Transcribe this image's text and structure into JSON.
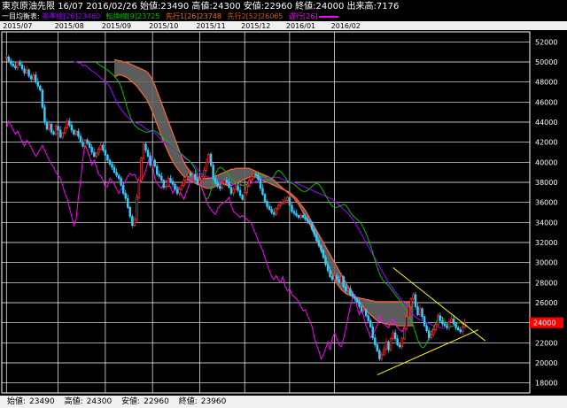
{
  "header": {
    "instrument": "東京原油先限",
    "contract": "16/07",
    "date": "2016/02/26",
    "open_label": "始値:",
    "open": "23490",
    "high_label": "高値:",
    "high": "24300",
    "low_label": "安値:",
    "low": "22960",
    "close_label": "終値:",
    "close": "24000",
    "volume_label": "出来高:",
    "volume": "7176"
  },
  "legend": {
    "title": "一目均衡表:",
    "items": [
      {
        "label": "基準線[26]23460",
        "color": "#9900ff"
      },
      {
        "label": "転換線[9]23725",
        "color": "#00c000"
      },
      {
        "label": "先行1[26]23748",
        "color": "#ff6600"
      },
      {
        "label": "先行2[52]26065",
        "color": "#c06000"
      },
      {
        "label": "遅行[26]",
        "color": "#ff00ff"
      }
    ]
  },
  "footer": {
    "open_label": "始値:",
    "open": "23490",
    "high_label": "高値:",
    "high": "24300",
    "low_label": "安値:",
    "low": "22960",
    "close_label": "終値:",
    "close": "23960"
  },
  "chart_data": {
    "type": "candlestick",
    "x_labels": [
      "2015/07",
      "2015/08",
      "2015/09",
      "2015/10",
      "2015/11",
      "2015/12",
      "2016/01",
      "2016/02"
    ],
    "y_ticks": [
      18000,
      20000,
      22000,
      24000,
      26000,
      28000,
      30000,
      32000,
      34000,
      36000,
      38000,
      40000,
      42000,
      44000,
      46000,
      48000,
      50000,
      52000
    ],
    "ylim": [
      17000,
      53000
    ],
    "last_price_label": "24000",
    "colors": {
      "up": "#ff3333",
      "down": "#33ccff",
      "kijun": "#9900ff",
      "tenkan": "#00c000",
      "chikou": "#ff00ff",
      "cloud_edge": "#ff6633",
      "cloud_fill": "#666666",
      "trend": "#ffff00",
      "grid": "#ffffff",
      "price_tag": "#ff0000"
    },
    "closes": [
      50500,
      50100,
      49800,
      49600,
      49400,
      50000,
      49700,
      49300,
      48900,
      49200,
      48600,
      48300,
      48700,
      48000,
      47600,
      47200,
      45500,
      44000,
      43300,
      43800,
      43000,
      42800,
      43600,
      43200,
      42500,
      42900,
      43400,
      44100,
      43700,
      43200,
      42800,
      43100,
      42600,
      42000,
      41600,
      42200,
      41900,
      41500,
      41000,
      40600,
      40900,
      41300,
      41700,
      41200,
      40700,
      40200,
      39800,
      39500,
      39000,
      38700,
      38400,
      37700,
      36900,
      36400,
      35500,
      34600,
      33700,
      34300,
      36500,
      38200,
      40400,
      41800,
      41200,
      40600,
      39700,
      40200,
      39600,
      38800,
      38600,
      38200,
      37500,
      37600,
      38400,
      38100,
      37800,
      37300,
      36900,
      37300,
      37700,
      38200,
      38600,
      38900,
      38700,
      38800,
      38300,
      37900,
      38200,
      38600,
      39200,
      40000,
      40800,
      39700,
      38400,
      37900,
      37600,
      37400,
      37900,
      38200,
      38000,
      37500,
      36900,
      37300,
      37600,
      37200,
      36700,
      36300,
      37000,
      37600,
      38200,
      38600,
      38800,
      38700,
      38300,
      37400,
      36800,
      36100,
      35600,
      35300,
      35000,
      34800,
      35400,
      35700,
      35900,
      36000,
      36200,
      36500,
      35700,
      35100,
      34900,
      34700,
      34500,
      34700,
      34500,
      34300,
      34100,
      33900,
      33300,
      32800,
      32200,
      31700,
      31200,
      30500,
      29800,
      29200,
      28600,
      28300,
      28700,
      28300,
      28000,
      28600,
      27600,
      27200,
      27400,
      26800,
      26600,
      26400,
      26100,
      25600,
      25200,
      25300,
      24700,
      24200,
      23600,
      22500,
      21800,
      21200,
      20400,
      20800,
      21400,
      22100,
      21300,
      22400,
      23000,
      22400,
      21800,
      21600,
      22400,
      23400,
      24600,
      25600,
      26400,
      26800,
      25600,
      24800,
      25400,
      24600,
      23700,
      23200,
      22500,
      22800,
      23300,
      23800,
      24700,
      24200,
      23900,
      23700,
      23500,
      24100,
      24400,
      23900,
      23500,
      23300,
      23100,
      23600,
      24000
    ],
    "kijun": [
      50000,
      50000,
      49900,
      49900,
      49600,
      49700,
      49500,
      49300,
      49100,
      49000,
      48800,
      48600,
      48400,
      48200,
      48000,
      47800,
      47500,
      47000,
      46500,
      46000,
      45600,
      45300,
      45000,
      44700,
      44500,
      44300,
      44100,
      44000,
      43900,
      43800,
      43700,
      43500,
      43300,
      43200,
      43100,
      43000,
      42900,
      42700,
      42500,
      42200,
      42000,
      41900,
      41800,
      41700,
      41500,
      41300,
      41100,
      40900,
      40700,
      40500,
      40300,
      40200,
      40000,
      39800,
      39600,
      39300,
      39000,
      38800,
      38700,
      38600,
      38500,
      38500,
      38400,
      38300,
      38200,
      38200,
      38100,
      38000,
      38000,
      37900,
      37800,
      37800,
      37800,
      37700,
      37700,
      37700,
      37700,
      37800,
      37800,
      37900,
      38000,
      38100,
      38200,
      38300,
      38300,
      38400,
      38400,
      38500,
      38500,
      38500,
      38500,
      38500,
      38400,
      38300,
      38200,
      38100,
      38100,
      38000,
      38000,
      37900,
      37800,
      37700,
      37600,
      37500,
      37400,
      37300,
      37200,
      37100,
      37000,
      36900,
      36800,
      36700,
      36600,
      36500,
      36400,
      36300,
      36100,
      35900,
      35700,
      35500,
      35300,
      35100,
      34900,
      34600,
      34300,
      34000,
      33600,
      33200,
      32800,
      32400,
      32000,
      31600,
      31200,
      30800,
      30400,
      30000,
      29600,
      29200,
      28800,
      28400,
      28000,
      27700,
      27400,
      27100,
      26800,
      26500,
      26200,
      25900,
      25600,
      25300,
      25000,
      24800,
      24600,
      24400,
      24300,
      24200,
      24100,
      24000,
      23900,
      23800,
      23700,
      23600,
      23600,
      23500,
      23500,
      23400
    ],
    "kijun_start": 30,
    "tenkan": [
      49900,
      49800,
      49600,
      49500,
      49300,
      49200,
      49000,
      48800,
      48600,
      48300,
      48000,
      47500,
      46800,
      46000,
      45200,
      44600,
      44000,
      43700,
      43500,
      43300,
      43200,
      43100,
      43000,
      43000,
      43100,
      43200,
      43100,
      43000,
      42800,
      42600,
      42400,
      42200,
      42000,
      41800,
      41600,
      41400,
      41200,
      41000,
      40800,
      40600,
      40400,
      40200,
      40000,
      39700,
      39300,
      38800,
      38100,
      37400,
      36700,
      36300,
      36500,
      37200,
      38000,
      38800,
      39300,
      39500,
      39400,
      39200,
      39000,
      38700,
      38400,
      38200,
      38000,
      37900,
      37800,
      37700,
      37700,
      37800,
      38000,
      38200,
      38400,
      38600,
      38700,
      38800,
      38700,
      38500,
      38300,
      38200,
      38300,
      38600,
      39000,
      39200,
      39100,
      38800,
      38500,
      38200,
      38000,
      37900,
      37800,
      37600,
      37400,
      37200,
      37100,
      37100,
      37200,
      37400,
      37600,
      37800,
      37900,
      37800,
      37500,
      37100,
      36700,
      36300,
      35900,
      35600,
      35500,
      35500,
      35600,
      35700,
      35800,
      35700,
      35400,
      35000,
      34700,
      34500,
      34300,
      34100,
      33800,
      33400,
      32900,
      32300,
      31700,
      31000,
      30200,
      29500,
      28900,
      28400,
      28100,
      27900,
      27700,
      27400,
      27100,
      26800,
      26500,
      26200,
      25900,
      25600,
      25200,
      24800,
      24300,
      23700,
      23000,
      22300,
      21800,
      21500,
      21600,
      22000,
      22500,
      23000,
      23500,
      24000,
      24400,
      24600,
      24500,
      24200,
      23900,
      23700,
      23600,
      23700,
      23900,
      24000,
      24000,
      23900,
      23800,
      23700
    ],
    "tenkan_start": 40,
    "senkou_a": [
      48500,
      48600,
      48700,
      48700,
      48600,
      48500,
      48400,
      48200,
      48000,
      47800,
      47600,
      47300,
      47000,
      46700,
      46400,
      46000,
      45500,
      45000,
      44400,
      43800,
      43200,
      42600,
      42000,
      41500,
      41000,
      40500,
      40100,
      39700,
      39400,
      39100,
      38800,
      38600,
      38400,
      38200,
      38100,
      38000,
      37900,
      37800,
      37700,
      37600,
      37500,
      37400,
      37400,
      37400,
      37500,
      37600,
      37700,
      37800,
      37800,
      37800,
      37700,
      37700,
      37700,
      37800,
      37900,
      38000,
      38100,
      38200,
      38300,
      38400,
      38500,
      38600,
      38600,
      38500,
      38400,
      38300,
      38200,
      38100,
      38000,
      37900,
      37800,
      37700,
      37600,
      37500,
      37400,
      37300,
      37200,
      37100,
      37000,
      36800,
      36600,
      36400,
      36100,
      35800,
      35500,
      35200,
      34800,
      34400,
      34000,
      33600,
      33200,
      32800,
      32400,
      32000,
      31600,
      31200,
      30800,
      30400,
      30000,
      29600,
      29200,
      28800,
      28400,
      28000,
      27600,
      27300,
      27000,
      26700,
      26400,
      26100,
      25800,
      25500,
      25200,
      25000,
      24800,
      24600,
      24400,
      24200,
      24100,
      24000,
      23900,
      23900,
      23800,
      23800,
      23800,
      23800,
      23700,
      23700,
      23700,
      23700,
      23700,
      23700,
      23700,
      23700
    ],
    "senkou_b": [
      50200,
      50200,
      50100,
      50100,
      50000,
      50000,
      49900,
      49800,
      49700,
      49600,
      49500,
      49400,
      49300,
      49200,
      49100,
      48900,
      48600,
      48200,
      47700,
      47100,
      46500,
      45900,
      45300,
      44700,
      44100,
      43500,
      42900,
      42300,
      41700,
      41100,
      40500,
      40000,
      39600,
      39300,
      39000,
      38800,
      38600,
      38500,
      38400,
      38400,
      38400,
      38400,
      38400,
      38400,
      38500,
      38600,
      38700,
      38800,
      38900,
      39000,
      39100,
      39200,
      39300,
      39300,
      39400,
      39400,
      39400,
      39400,
      39400,
      39400,
      39400,
      39300,
      39200,
      39100,
      39000,
      38900,
      38800,
      38700,
      38600,
      38500,
      38400,
      38200,
      38000,
      37800,
      37600,
      37400,
      37200,
      37000,
      36800,
      36600,
      36400,
      36100,
      35800,
      35400,
      35000,
      34600,
      34200,
      33800,
      33300,
      32800,
      32300,
      31800,
      31300,
      30800,
      30300,
      29800,
      29300,
      28800,
      28300,
      27900,
      27600,
      27300,
      27100,
      26900,
      26800,
      26700,
      26700,
      26600,
      26500,
      26500,
      26400,
      26400,
      26300,
      26300,
      26200,
      26200,
      26100,
      26100,
      26100,
      26100,
      26100,
      26100,
      26100,
      26100,
      26100,
      26100,
      26100,
      26100,
      26100,
      26100,
      26100,
      26100,
      26100,
      26100
    ],
    "senkou_start": 48,
    "trendlines": [
      {
        "from": [
          172,
          29500
        ],
        "to": [
          213,
          22200
        ]
      },
      {
        "from": [
          165,
          18800
        ],
        "to": [
          210,
          23300
        ]
      }
    ]
  }
}
